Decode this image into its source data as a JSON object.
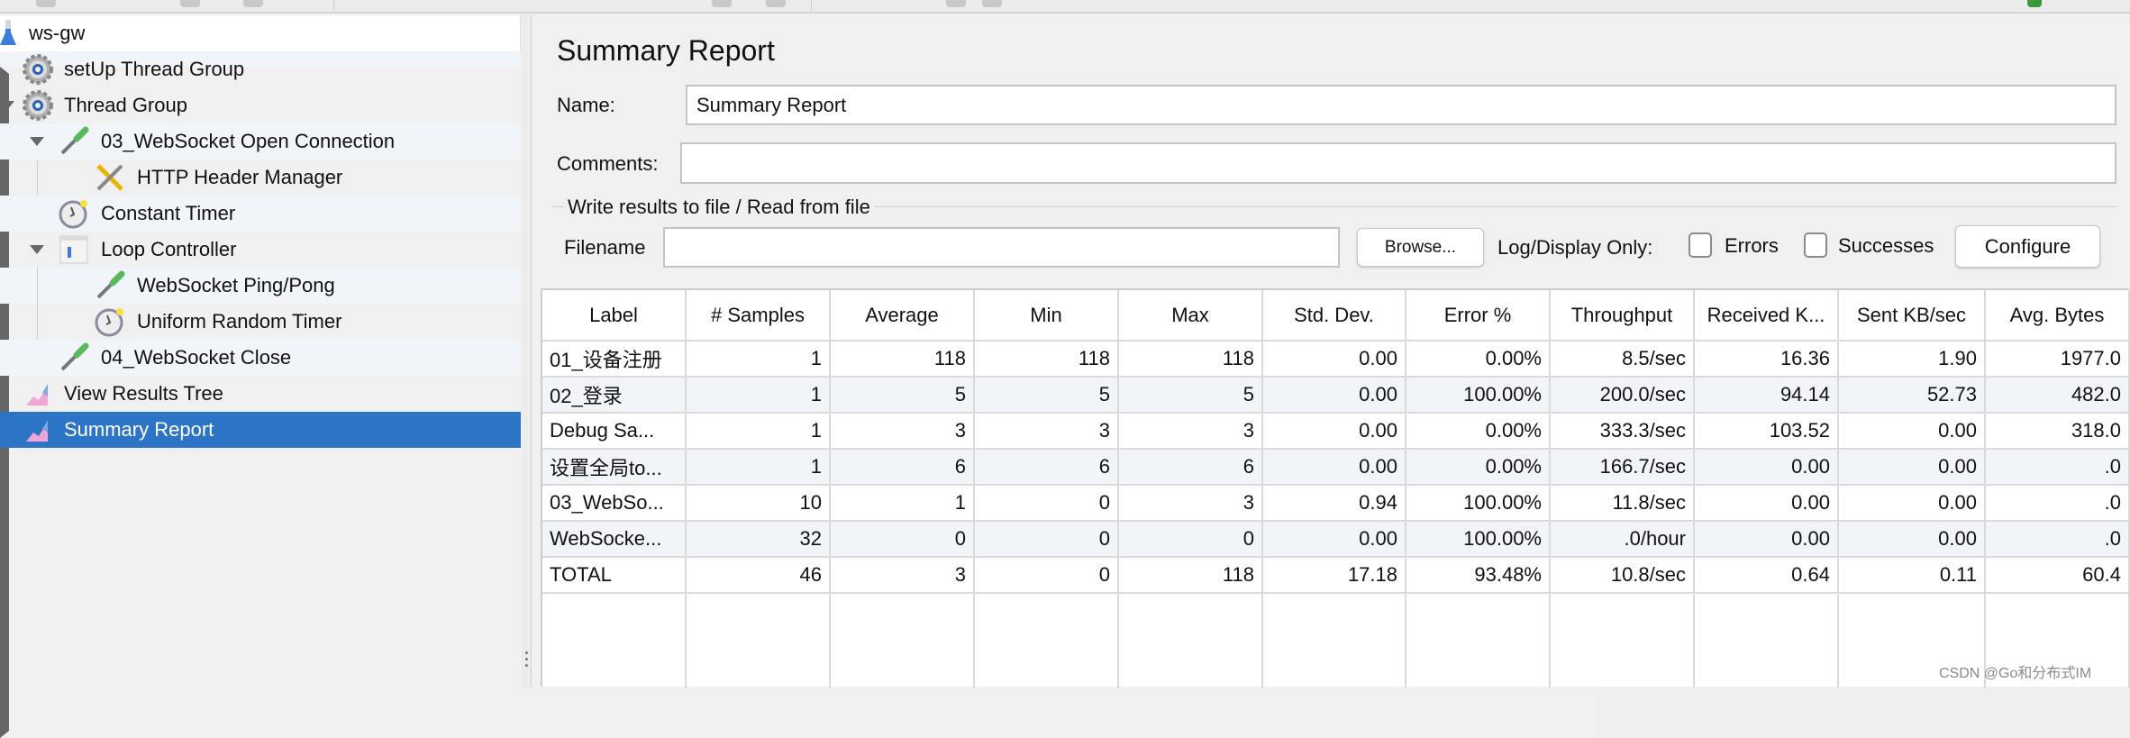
{
  "tree": {
    "items": [
      {
        "label": "ws-gw",
        "icon": "test-plan-flask-icon",
        "expander": "none"
      },
      {
        "label": "setUp Thread Group",
        "icon": "gear-icon",
        "expander": "collapsed"
      },
      {
        "label": "Thread Group",
        "icon": "gear-icon",
        "expander": "expanded"
      },
      {
        "label": "03_WebSocket Open Connection",
        "icon": "pipette-sampler-icon",
        "expander": "expanded"
      },
      {
        "label": "HTTP Header Manager",
        "icon": "wrench-screwdriver-icon",
        "expander": "none"
      },
      {
        "label": "Constant Timer",
        "icon": "stopwatch-icon",
        "expander": "none"
      },
      {
        "label": "Loop Controller",
        "icon": "controller-icon",
        "expander": "expanded"
      },
      {
        "label": "WebSocket Ping/Pong",
        "icon": "pipette-sampler-icon",
        "expander": "none"
      },
      {
        "label": "Uniform Random Timer",
        "icon": "stopwatch-icon",
        "expander": "none"
      },
      {
        "label": "04_WebSocket Close",
        "icon": "pipette-sampler-icon",
        "expander": "none"
      },
      {
        "label": "View Results Tree",
        "icon": "chart-listener-icon",
        "expander": "none"
      },
      {
        "label": "Summary Report",
        "icon": "chart-listener-icon",
        "expander": "none",
        "selected": true
      }
    ],
    "selected_color": "#2b74c6"
  },
  "panel": {
    "title": "Summary Report",
    "name_label": "Name:",
    "name_value": "Summary Report",
    "comments_label": "Comments:",
    "comments_value": "",
    "file_group_title": "Write results to file / Read from file",
    "filename_label": "Filename",
    "filename_value": "",
    "browse_label": "Browse...",
    "log_display_label": "Log/Display Only:",
    "errors_label": "Errors",
    "errors_checked": false,
    "successes_label": "Successes",
    "successes_checked": false,
    "configure_label": "Configure"
  },
  "table": {
    "headers": [
      "Label",
      "# Samples",
      "Average",
      "Min",
      "Max",
      "Std. Dev.",
      "Error %",
      "Throughput",
      "Received K...",
      "Sent KB/sec",
      "Avg. Bytes"
    ],
    "rows": [
      [
        "01_设备注册",
        "1",
        "118",
        "118",
        "118",
        "0.00",
        "0.00%",
        "8.5/sec",
        "16.36",
        "1.90",
        "1977.0"
      ],
      [
        "02_登录",
        "1",
        "5",
        "5",
        "5",
        "0.00",
        "100.00%",
        "200.0/sec",
        "94.14",
        "52.73",
        "482.0"
      ],
      [
        "Debug Sa...",
        "1",
        "3",
        "3",
        "3",
        "0.00",
        "0.00%",
        "333.3/sec",
        "103.52",
        "0.00",
        "318.0"
      ],
      [
        "设置全局to...",
        "1",
        "6",
        "6",
        "6",
        "0.00",
        "0.00%",
        "166.7/sec",
        "0.00",
        "0.00",
        ".0"
      ],
      [
        "03_WebSo...",
        "10",
        "1",
        "0",
        "3",
        "0.94",
        "100.00%",
        "11.8/sec",
        "0.00",
        "0.00",
        ".0"
      ],
      [
        "WebSocke...",
        "32",
        "0",
        "0",
        "0",
        "0.00",
        "100.00%",
        ".0/hour",
        "0.00",
        "0.00",
        ".0"
      ],
      [
        "TOTAL",
        "46",
        "3",
        "0",
        "118",
        "17.18",
        "93.48%",
        "10.8/sec",
        "0.64",
        "0.11",
        "60.4"
      ]
    ]
  },
  "watermark": "CSDN @Go和分布式IM"
}
